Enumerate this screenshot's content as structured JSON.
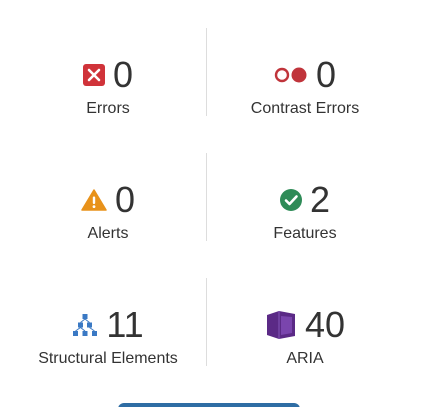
{
  "stats": [
    {
      "label": "Errors",
      "count": "0",
      "icon": "error-x-icon",
      "color": "#d0333a"
    },
    {
      "label": "Contrast Errors",
      "count": "0",
      "icon": "contrast-icon",
      "color": "#c0343b"
    },
    {
      "label": "Alerts",
      "count": "0",
      "icon": "alert-triangle-icon",
      "color": "#e8921a"
    },
    {
      "label": "Features",
      "count": "2",
      "icon": "check-circle-icon",
      "color": "#2e8b57"
    },
    {
      "label": "Structural Elements",
      "count": "11",
      "icon": "structure-icon",
      "color": "#3a79c4"
    },
    {
      "label": "ARIA",
      "count": "40",
      "icon": "aria-cube-icon",
      "color": "#5b2a86"
    }
  ]
}
